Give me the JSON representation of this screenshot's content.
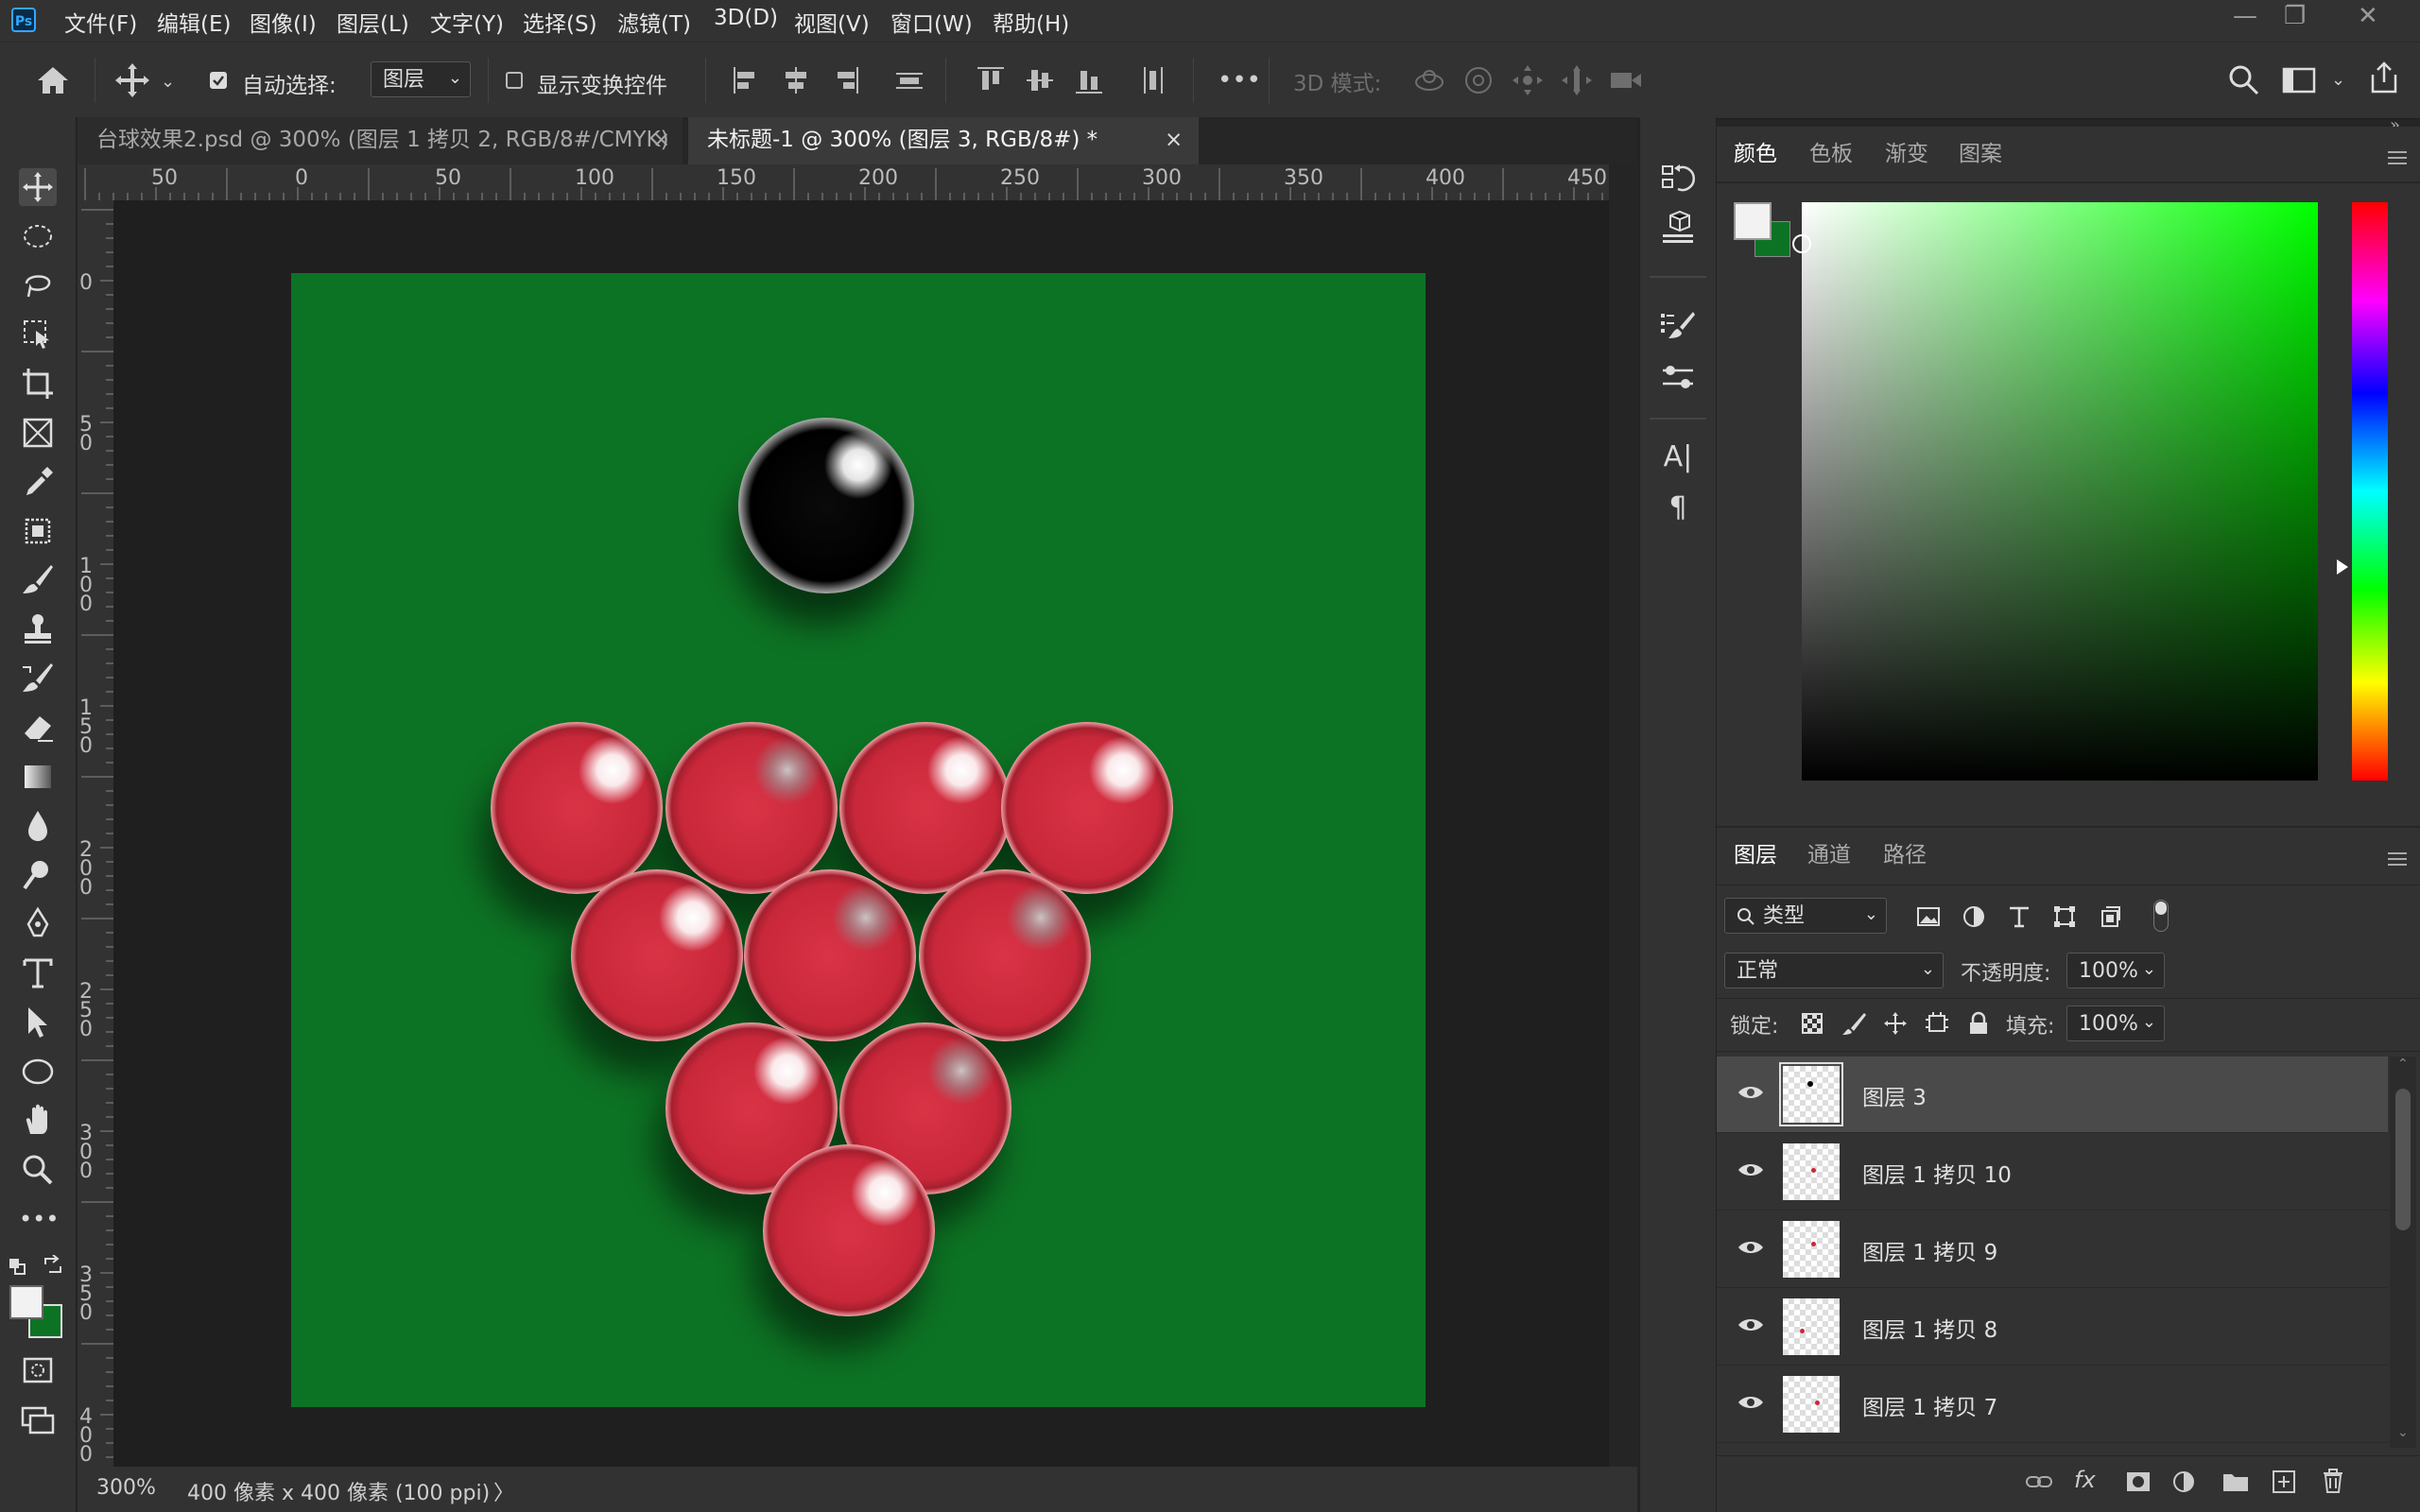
{
  "app": {
    "logo_text": "Ps"
  },
  "menu": [
    "文件(F)",
    "编辑(E)",
    "图像(I)",
    "图层(L)",
    "文字(Y)",
    "选择(S)",
    "滤镜(T)",
    "3D(D)",
    "视图(V)",
    "窗口(W)",
    "帮助(H)"
  ],
  "window_controls": {
    "minimize": "—",
    "restore": "❐",
    "close": "✕"
  },
  "options": {
    "auto_select_label": "自动选择:",
    "auto_select_checked": true,
    "auto_select_target": "图层",
    "show_transform_label": "显示变换控件",
    "show_transform_checked": false,
    "more_label": "•••",
    "mode3d_label": "3D 模式:"
  },
  "tabs": [
    {
      "title": "台球效果2.psd @ 300% (图层 1 拷贝 2, RGB/8#/CMYK)",
      "active": false
    },
    {
      "title": "未标题-1 @ 300% (图层 3, RGB/8#) *",
      "active": true
    }
  ],
  "tab_close_glyph": "×",
  "ruler": {
    "h_labels": [
      "50",
      "0",
      "50",
      "100",
      "150",
      "200",
      "250",
      "300",
      "350",
      "400",
      "450"
    ],
    "v_labels": [
      "0",
      "5\n0",
      "1\n0\n0",
      "1\n5\n0",
      "2\n0\n0",
      "2\n5\n0",
      "3\n0\n0",
      "3\n5\n0",
      "4\n0\n0"
    ]
  },
  "document": {
    "bg_color": "#0d7324",
    "black_ball_color": "#000000",
    "red_ball_color": "#c9283a",
    "red_ball_count": 10
  },
  "status": {
    "zoom": "300%",
    "doc_info": "400 像素 x 400 像素 (100 ppi)",
    "arrow": "〉"
  },
  "color_panel": {
    "tabs": [
      "颜色",
      "色板",
      "渐变",
      "图案"
    ],
    "active_tab": "颜色",
    "foreground": "#f2f2f2",
    "background": "#0d7324",
    "field_hue": "#00ff00"
  },
  "layers_panel": {
    "tabs": [
      "图层",
      "通道",
      "路径"
    ],
    "active_tab": "图层",
    "filter_label": "类型",
    "blend_mode": "正常",
    "opacity_label": "不透明度:",
    "opacity_value": "100%",
    "lock_label": "锁定:",
    "fill_label": "填充:",
    "fill_value": "100%",
    "layers": [
      {
        "name": "图层 3",
        "selected": true,
        "visible": true
      },
      {
        "name": "图层 1 拷贝 10",
        "selected": false,
        "visible": true
      },
      {
        "name": "图层 1 拷贝 9",
        "selected": false,
        "visible": true
      },
      {
        "name": "图层 1 拷贝 8",
        "selected": false,
        "visible": true
      },
      {
        "name": "图层 1 拷贝 7",
        "selected": false,
        "visible": true
      }
    ]
  },
  "icons": {
    "tools": [
      "move-icon",
      "marquee-icon",
      "lasso-icon",
      "object-select-icon",
      "crop-icon",
      "frame-icon",
      "eyedropper-icon",
      "patch-icon",
      "brush-icon",
      "stamp-icon",
      "history-brush-icon",
      "eraser-icon",
      "gradient-icon",
      "blur-icon",
      "dodge-icon",
      "pen-icon",
      "type-icon",
      "path-select-icon",
      "ellipse-icon",
      "hand-icon",
      "zoom-icon",
      "more-tools-icon"
    ]
  }
}
